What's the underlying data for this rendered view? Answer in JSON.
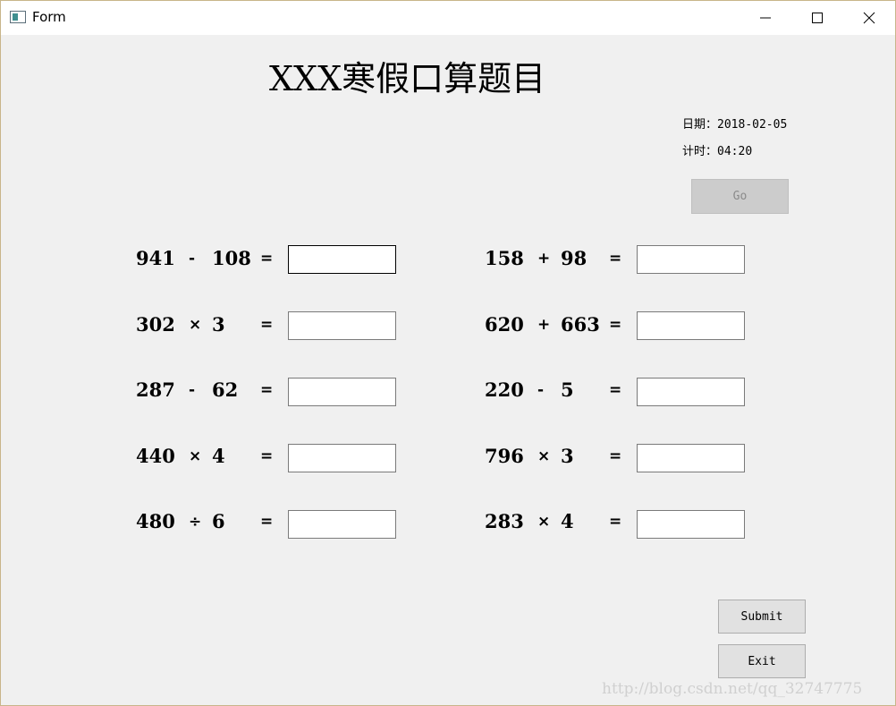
{
  "window": {
    "title": "Form",
    "icon": "form-window-icon"
  },
  "heading": "XXX寒假口算题目",
  "info": {
    "date_label": "日期：",
    "date_value": "2018-02-05",
    "timer_label": "计时：",
    "timer_value": "04:20"
  },
  "buttons": {
    "go": "Go",
    "submit": "Submit",
    "exit": "Exit"
  },
  "problems": [
    {
      "a": "941",
      "op": "-",
      "b": "108",
      "eq": "=",
      "answer": ""
    },
    {
      "a": "302",
      "op": "×",
      "b": "3",
      "eq": "=",
      "answer": ""
    },
    {
      "a": "287",
      "op": "-",
      "b": "62",
      "eq": "=",
      "answer": ""
    },
    {
      "a": "440",
      "op": "×",
      "b": "4",
      "eq": "=",
      "answer": ""
    },
    {
      "a": "480",
      "op": "÷",
      "b": "6",
      "eq": "=",
      "answer": ""
    },
    {
      "a": "158",
      "op": "+",
      "b": "98",
      "eq": "=",
      "answer": ""
    },
    {
      "a": "620",
      "op": "+",
      "b": "663",
      "eq": "=",
      "answer": ""
    },
    {
      "a": "220",
      "op": "-",
      "b": "5",
      "eq": "=",
      "answer": ""
    },
    {
      "a": "796",
      "op": "×",
      "b": "3",
      "eq": "=",
      "answer": ""
    },
    {
      "a": "283",
      "op": "×",
      "b": "4",
      "eq": "=",
      "answer": ""
    }
  ],
  "watermark": "http://blog.csdn.net/qq_32747775",
  "colors": {
    "window_bg": "#f0f0f0",
    "titlebar_bg": "#ffffff",
    "disabled_button": "#cccccc",
    "button": "#e1e1e1"
  }
}
